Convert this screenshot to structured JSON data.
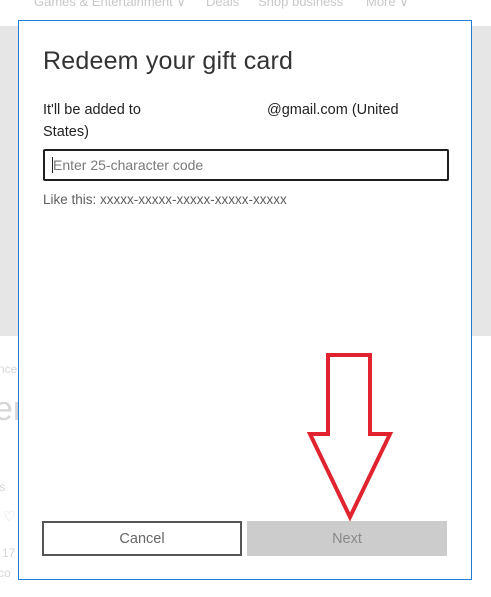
{
  "background": {
    "nav_items": [
      "Games & Entertainment ∨",
      "Deals",
      "Shop business",
      "More ∨"
    ],
    "fragments": [
      "nce",
      "er",
      "ts",
      "17",
      "co"
    ]
  },
  "dialog": {
    "title": "Redeem your gift card",
    "account_prefix": "It'll be added to",
    "account_email": "@gmail.com (United",
    "account_suffix": "States)",
    "code_placeholder": "Enter 25-character code",
    "code_value": "",
    "hint": "Like this: xxxxx-xxxxx-xxxxx-xxxxx-xxxxx",
    "cancel_label": "Cancel",
    "next_label": "Next"
  },
  "annotation": {
    "arrow_icon": "down-arrow-icon",
    "arrow_color": "#e0232e"
  }
}
